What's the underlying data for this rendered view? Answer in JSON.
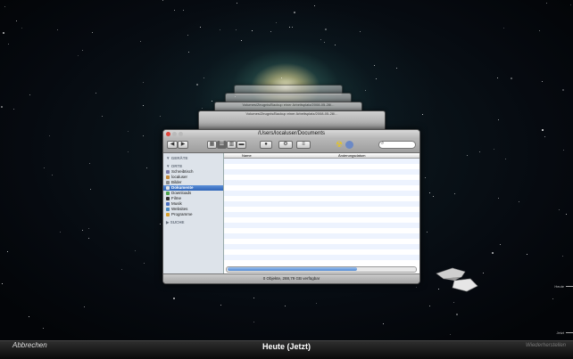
{
  "window": {
    "title": "/Users/localuser/Documents",
    "stack_title": "Volumes/Zeugnis/Backup einer Arbeitsplatz/2008-05-28/..."
  },
  "sidebar": {
    "headers": {
      "devices": "▼ GERÄTE",
      "places": "▼ ORTE",
      "search": "▶ SUCHE"
    },
    "items": [
      {
        "label": "Schreibtisch",
        "color": "#7a7aa8",
        "selected": false
      },
      {
        "label": "localuser",
        "color": "#c78b3c",
        "selected": false
      },
      {
        "label": "Bilder",
        "color": "#8a8a8a",
        "selected": false
      },
      {
        "label": "Dokumente",
        "color": "#e6e6e6",
        "selected": true
      },
      {
        "label": "Downloads",
        "color": "#4aa04a",
        "selected": false
      },
      {
        "label": "Filme",
        "color": "#333333",
        "selected": false
      },
      {
        "label": "Musik",
        "color": "#4a6fc0",
        "selected": false
      },
      {
        "label": "Websites",
        "color": "#4a8ac0",
        "selected": false
      },
      {
        "label": "Programme",
        "color": "#d6a030",
        "selected": false
      }
    ]
  },
  "columns": {
    "name": "Name",
    "date": "Änderungsdatum"
  },
  "status_text": "0 Objekte, 288,79 GB verfügbar",
  "bottombar": {
    "cancel": "Abbrechen",
    "current": "Heute (Jetzt)",
    "restore": "Wiederherstellen"
  },
  "timeline": {
    "today": "Heute",
    "now": "Jetzt"
  },
  "icons": [
    "back-icon",
    "forward-icon",
    "view-icon",
    "eye-icon",
    "gear-icon",
    "arrange-icon",
    "search-icon",
    "rocket-icon"
  ]
}
